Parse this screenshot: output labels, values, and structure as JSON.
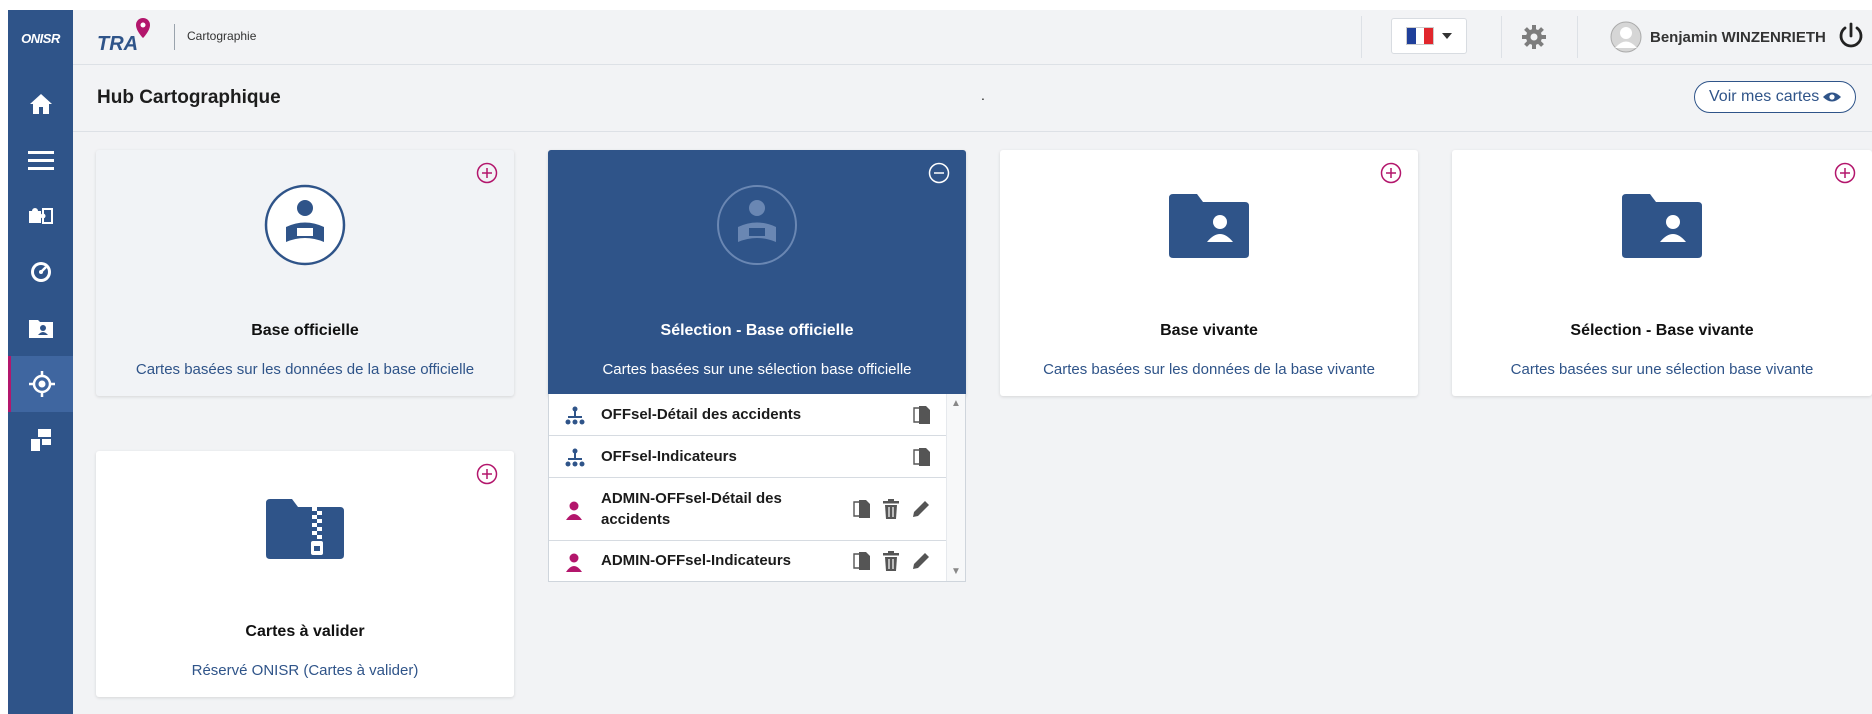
{
  "sidebar": {
    "logo": "ONISR",
    "items": [
      {
        "icon": "home-icon"
      },
      {
        "icon": "menu-icon"
      },
      {
        "icon": "puzzle-icon"
      },
      {
        "icon": "gauge-icon"
      },
      {
        "icon": "folder-user-icon"
      },
      {
        "icon": "crosshair-icon",
        "active": true
      },
      {
        "icon": "network-icon"
      }
    ]
  },
  "topbar": {
    "brand": "TRA",
    "section": "Cartographie",
    "language_icon": "flag-france-icon",
    "user_name": "Benjamin WINZENRIETH"
  },
  "page": {
    "title": "Hub Cartographique",
    "dot": ".",
    "voir_label": "Voir mes cartes"
  },
  "cards": [
    {
      "title": "Base officielle",
      "desc": "Cartes basées sur les données de la base officielle"
    },
    {
      "title": "Sélection - Base officielle",
      "desc": "Cartes basées sur une sélection base officielle"
    },
    {
      "title": "Base vivante",
      "desc": "Cartes basées sur les données de la base vivante"
    },
    {
      "title": "Sélection - Base vivante",
      "desc": "Cartes basées sur une sélection base vivante"
    },
    {
      "title": "Cartes à valider",
      "desc": "Réservé ONISR (Cartes à valider)"
    }
  ],
  "list": [
    {
      "label": "OFFsel-Détail des accidents",
      "type": "shared"
    },
    {
      "label": "OFFsel-Indicateurs",
      "type": "shared"
    },
    {
      "label": "ADMIN-OFFsel-Détail des accidents",
      "type": "own"
    },
    {
      "label": "ADMIN-OFFsel-Indicateurs",
      "type": "own"
    }
  ],
  "colors": {
    "primary": "#2f5489",
    "accent": "#b3166c",
    "background": "#f2f3f5"
  }
}
